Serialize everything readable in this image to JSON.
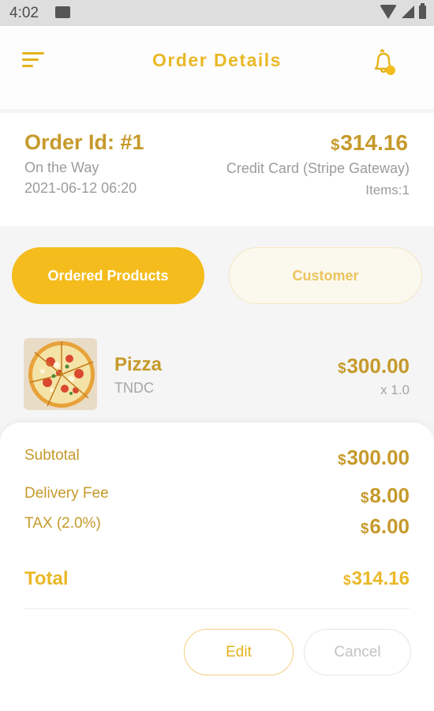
{
  "status_bar": {
    "time": "4:02"
  },
  "header": {
    "title": "Order Details"
  },
  "order": {
    "id_label": "Order Id: #1",
    "status": "On the Way",
    "datetime": "2021-06-12 06:20",
    "currency_symbol": "$",
    "total_amount": "314.16",
    "payment_method": "Credit Card (Stripe Gateway)",
    "items_count": "Items:1"
  },
  "tabs": [
    {
      "label": "Ordered Products",
      "active": true
    },
    {
      "label": "Customer",
      "active": false
    }
  ],
  "products": [
    {
      "name": "Pizza",
      "sku": "TNDC",
      "currency_symbol": "$",
      "price": "300.00",
      "quantity": "x 1.0"
    }
  ],
  "totals": {
    "subtotal_label": "Subtotal",
    "subtotal_currency": "$",
    "subtotal_value": "300.00",
    "delivery_label": "Delivery Fee",
    "delivery_currency": "$",
    "delivery_value": "8.00",
    "tax_label": "TAX (2.0%)",
    "tax_currency": "$",
    "tax_value": "6.00",
    "total_label": "Total",
    "total_currency": "$",
    "total_value": "314.16"
  },
  "actions": {
    "edit_label": "Edit",
    "cancel_label": "Cancel"
  },
  "colors": {
    "accent": "#f4bc1c",
    "accent_text": "#c69a2b",
    "muted": "#9c9c9c"
  },
  "icons": [
    "menu-icon",
    "bell-icon",
    "notification-dot-icon",
    "wifi-icon",
    "signal-icon",
    "battery-icon",
    "mail-icon"
  ]
}
